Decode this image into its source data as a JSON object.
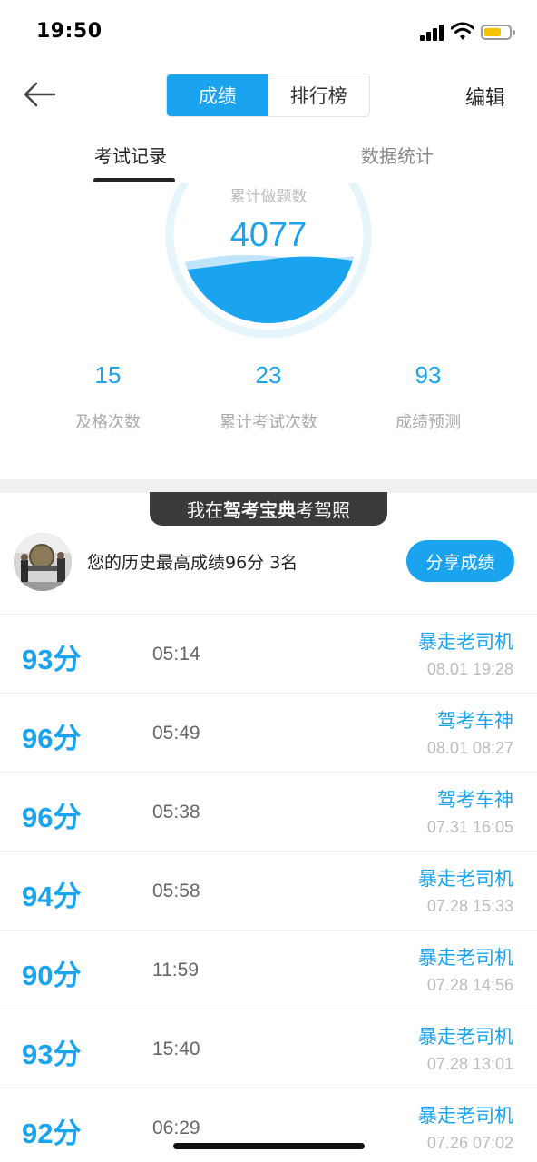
{
  "status_bar": {
    "time": "19:50"
  },
  "nav": {
    "seg_scores": "成绩",
    "seg_ranking": "排行榜",
    "edit": "编辑"
  },
  "tabs": {
    "records": "考试记录",
    "stats": "数据统计"
  },
  "gauge": {
    "label": "累计做题数",
    "value": "4077"
  },
  "stats": [
    {
      "value": "15",
      "label": "及格次数"
    },
    {
      "value": "23",
      "label": "累计考试次数"
    },
    {
      "value": "93",
      "label": "成绩预测"
    }
  ],
  "promo": {
    "prefix": "我在",
    "brand": "驾考宝典",
    "suffix": "考驾照"
  },
  "best": {
    "text": "您的历史最高成绩96分  3名",
    "share": "分享成绩"
  },
  "records": [
    {
      "score": "93分",
      "time": "05:14",
      "title": "暴走老司机",
      "date": "08.01 19:28"
    },
    {
      "score": "96分",
      "time": "05:49",
      "title": "驾考车神",
      "date": "08.01 08:27"
    },
    {
      "score": "96分",
      "time": "05:38",
      "title": "驾考车神",
      "date": "07.31 16:05"
    },
    {
      "score": "94分",
      "time": "05:58",
      "title": "暴走老司机",
      "date": "07.28 15:33"
    },
    {
      "score": "90分",
      "time": "11:59",
      "title": "暴走老司机",
      "date": "07.28 14:56"
    },
    {
      "score": "93分",
      "time": "15:40",
      "title": "暴走老司机",
      "date": "07.28 13:01"
    },
    {
      "score": "92分",
      "time": "06:29",
      "title": "暴走老司机",
      "date": "07.26 07:02"
    }
  ],
  "colors": {
    "accent": "#1aa3ee",
    "battery": "#f5c400"
  }
}
